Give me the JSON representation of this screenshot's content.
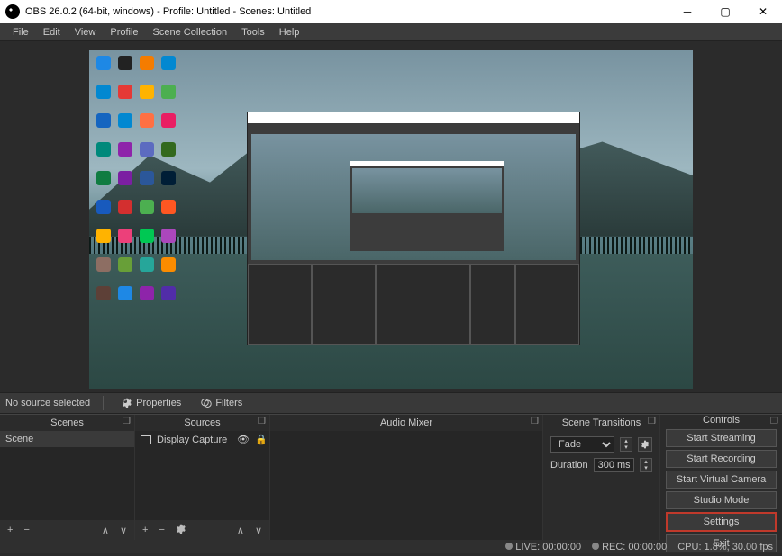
{
  "window": {
    "title": "OBS 26.0.2 (64-bit, windows) - Profile: Untitled - Scenes: Untitled"
  },
  "menubar": {
    "file": "File",
    "edit": "Edit",
    "view": "View",
    "profile": "Profile",
    "scene_collection": "Scene Collection",
    "tools": "Tools",
    "help": "Help"
  },
  "source_toolbar": {
    "no_source": "No source selected",
    "properties": "Properties",
    "filters": "Filters"
  },
  "panels": {
    "scenes": {
      "title": "Scenes",
      "items": [
        "Scene"
      ]
    },
    "sources": {
      "title": "Sources",
      "items": [
        {
          "label": "Display Capture"
        }
      ]
    },
    "audio_mixer": {
      "title": "Audio Mixer"
    },
    "transitions": {
      "title": "Scene Transitions",
      "selected": "Fade",
      "duration_label": "Duration",
      "duration_value": "300 ms"
    },
    "controls": {
      "title": "Controls",
      "start_streaming": "Start Streaming",
      "start_recording": "Start Recording",
      "start_virtual_camera": "Start Virtual Camera",
      "studio_mode": "Studio Mode",
      "settings": "Settings",
      "exit": "Exit"
    }
  },
  "statusbar": {
    "live": "LIVE: 00:00:00",
    "rec": "REC: 00:00:00",
    "cpu": "CPU: 1.8%, 30.00 fps"
  },
  "icon_colors": [
    "#1e88e5",
    "#222",
    "#f57c00",
    "#0288d1",
    "#0288d1",
    "#e53935",
    "#ffb300",
    "#4caf50",
    "#1565c0",
    "#0288d1",
    "#ff7043",
    "#e91e63",
    "#00897b",
    "#8e24aa",
    "#5c6bc0",
    "#33691e",
    "#107c41",
    "#7b1fa2",
    "#2b579a",
    "#001e36",
    "#185abd",
    "#d32f2f",
    "#4caf50",
    "#ff5722",
    "#ffb300",
    "#ec407a",
    "#00c853",
    "#ab47bc",
    "#8d6e63",
    "#689f38",
    "#26a69a",
    "#fb8c00",
    "#5d4037",
    "#1e88e5",
    "#8e24aa",
    "#512da8"
  ]
}
